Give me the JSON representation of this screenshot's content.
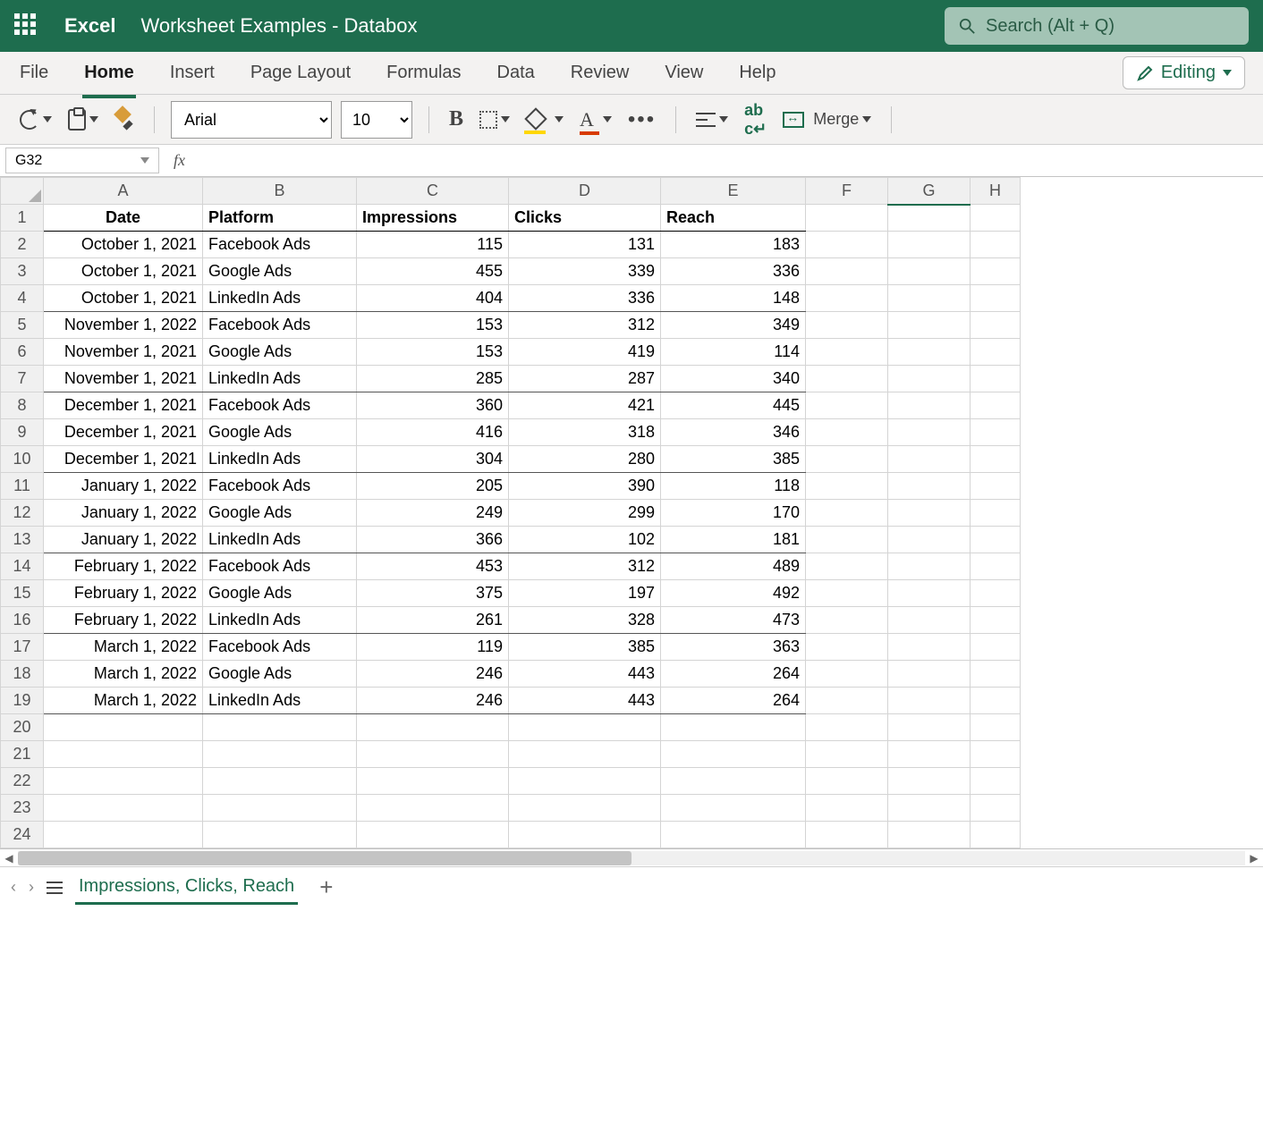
{
  "app": {
    "name": "Excel",
    "document_title": "Worksheet Examples - Databox",
    "search_placeholder": "Search (Alt + Q)"
  },
  "ribbon": {
    "tabs": [
      "File",
      "Home",
      "Insert",
      "Page Layout",
      "Formulas",
      "Data",
      "Review",
      "View",
      "Help"
    ],
    "active_tab": "Home",
    "editing_button": "Editing"
  },
  "toolbar": {
    "font_name": "Arial",
    "font_size": "10",
    "merge_label": "Merge"
  },
  "formula_bar": {
    "name_box": "G32",
    "fx_label": "fx",
    "formula_value": ""
  },
  "columns": [
    "A",
    "B",
    "C",
    "D",
    "E",
    "F",
    "G",
    "H"
  ],
  "selected_column": "G",
  "row_headers": [
    1,
    2,
    3,
    4,
    5,
    6,
    7,
    8,
    9,
    10,
    11,
    12,
    13,
    14,
    15,
    16,
    17,
    18,
    19,
    20,
    21,
    22,
    23,
    24
  ],
  "data_headers": {
    "A": "Date",
    "B": "Platform",
    "C": "Impressions",
    "D": "Clicks",
    "E": "Reach"
  },
  "data_rows": [
    {
      "date": "October 1, 2021",
      "platform": "Facebook Ads",
      "impressions": 115,
      "clicks": 131,
      "reach": 183,
      "group_end": false
    },
    {
      "date": "October 1, 2021",
      "platform": "Google Ads",
      "impressions": 455,
      "clicks": 339,
      "reach": 336,
      "group_end": false
    },
    {
      "date": "October 1, 2021",
      "platform": "LinkedIn Ads",
      "impressions": 404,
      "clicks": 336,
      "reach": 148,
      "group_end": true
    },
    {
      "date": "November 1, 2022",
      "platform": "Facebook Ads",
      "impressions": 153,
      "clicks": 312,
      "reach": 349,
      "group_end": false
    },
    {
      "date": "November 1, 2021",
      "platform": "Google Ads",
      "impressions": 153,
      "clicks": 419,
      "reach": 114,
      "group_end": false
    },
    {
      "date": "November 1, 2021",
      "platform": "LinkedIn Ads",
      "impressions": 285,
      "clicks": 287,
      "reach": 340,
      "group_end": true
    },
    {
      "date": "December 1, 2021",
      "platform": "Facebook Ads",
      "impressions": 360,
      "clicks": 421,
      "reach": 445,
      "group_end": false
    },
    {
      "date": "December 1, 2021",
      "platform": "Google Ads",
      "impressions": 416,
      "clicks": 318,
      "reach": 346,
      "group_end": false
    },
    {
      "date": "December 1, 2021",
      "platform": "LinkedIn Ads",
      "impressions": 304,
      "clicks": 280,
      "reach": 385,
      "group_end": true
    },
    {
      "date": "January 1, 2022",
      "platform": "Facebook Ads",
      "impressions": 205,
      "clicks": 390,
      "reach": 118,
      "group_end": false
    },
    {
      "date": "January 1, 2022",
      "platform": "Google Ads",
      "impressions": 249,
      "clicks": 299,
      "reach": 170,
      "group_end": false
    },
    {
      "date": "January 1, 2022",
      "platform": "LinkedIn Ads",
      "impressions": 366,
      "clicks": 102,
      "reach": 181,
      "group_end": true
    },
    {
      "date": "February 1, 2022",
      "platform": "Facebook Ads",
      "impressions": 453,
      "clicks": 312,
      "reach": 489,
      "group_end": false
    },
    {
      "date": "February 1, 2022",
      "platform": "Google Ads",
      "impressions": 375,
      "clicks": 197,
      "reach": 492,
      "group_end": false
    },
    {
      "date": "February 1, 2022",
      "platform": "LinkedIn Ads",
      "impressions": 261,
      "clicks": 328,
      "reach": 473,
      "group_end": true
    },
    {
      "date": "March 1, 2022",
      "platform": "Facebook Ads",
      "impressions": 119,
      "clicks": 385,
      "reach": 363,
      "group_end": false
    },
    {
      "date": "March 1, 2022",
      "platform": "Google Ads",
      "impressions": 246,
      "clicks": 443,
      "reach": 264,
      "group_end": false
    },
    {
      "date": "March 1, 2022",
      "platform": "LinkedIn Ads",
      "impressions": 246,
      "clicks": 443,
      "reach": 264,
      "group_end": true
    }
  ],
  "sheet_bar": {
    "active_sheet": "Impressions, Clicks, Reach"
  }
}
